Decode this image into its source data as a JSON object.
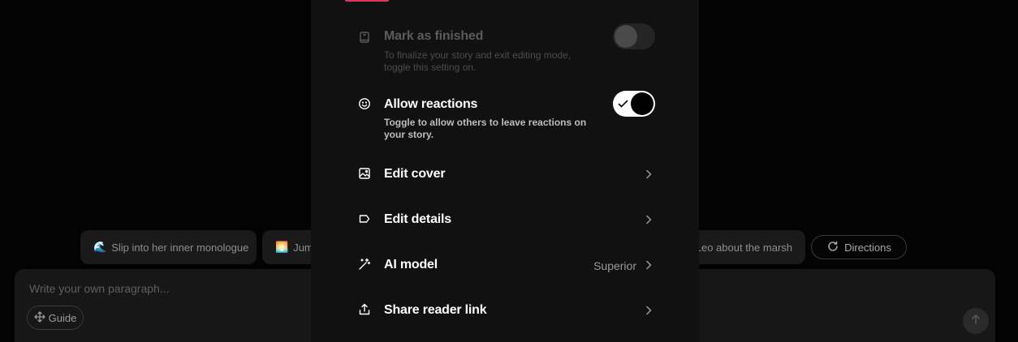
{
  "background": {
    "suggestions": [
      {
        "emoji": "🌊",
        "label": "Slip into her inner monologue"
      },
      {
        "emoji": "🌅",
        "label": "Jum"
      },
      {
        "emoji": "",
        "label": "Leo about the marsh"
      }
    ],
    "directions_label": "Directions",
    "composer": {
      "placeholder": "Write your own paragraph...",
      "guide_label": "Guide"
    }
  },
  "settings": {
    "mark_finished": {
      "title": "Mark as finished",
      "description": "To finalize your story and exit editing mode, toggle this setting on.",
      "enabled": false
    },
    "allow_reactions": {
      "title": "Allow reactions",
      "description": "Toggle to allow others to leave reactions on your story.",
      "enabled": true
    },
    "edit_cover": {
      "title": "Edit cover"
    },
    "edit_details": {
      "title": "Edit details"
    },
    "ai_model": {
      "title": "AI model",
      "value": "Superior"
    },
    "share_link": {
      "title": "Share reader link"
    }
  },
  "colors": {
    "accent": "#e0345a",
    "modal_bg": "#111111",
    "page_bg": "#030303"
  }
}
